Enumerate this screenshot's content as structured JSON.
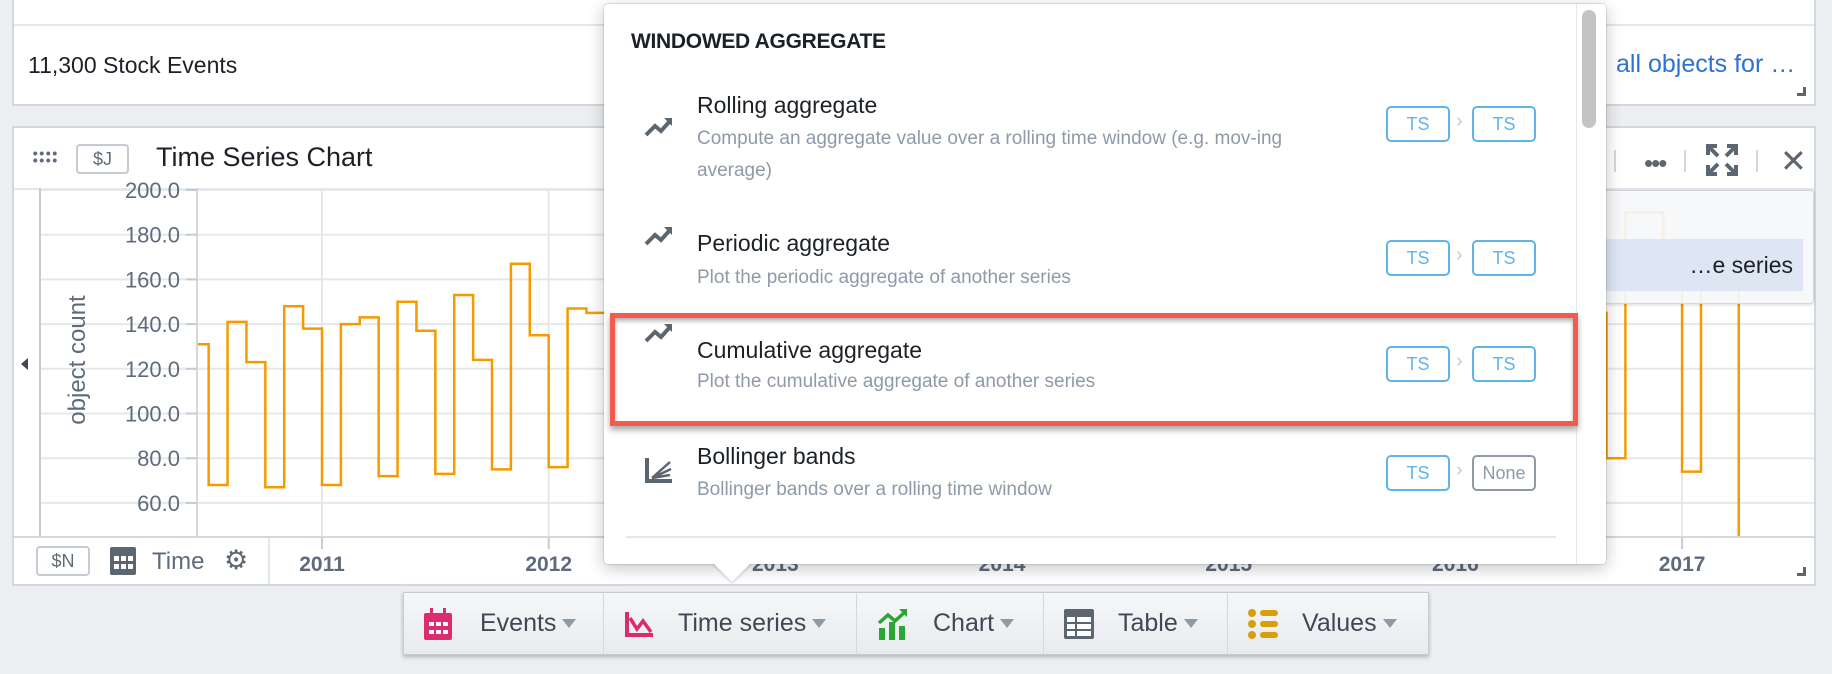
{
  "top_panel": {
    "title": "11,300 Stock Events",
    "link": "all objects for …"
  },
  "chart_panel": {
    "badge": "$J",
    "title": "Time Series Chart",
    "toolbar_icons": [
      "more-icon",
      "maximize-icon",
      "close-icon"
    ],
    "axis_badge": "$N",
    "axis_label": "Time",
    "popover_item": "…e series"
  },
  "chart_data": {
    "type": "line",
    "step": true,
    "ylabel": "object count",
    "ylim": [
      45,
      201
    ],
    "yticks": [
      "60.0",
      "80.0",
      "100.0",
      "120.0",
      "140.0",
      "160.0",
      "180.0",
      "200.0"
    ],
    "xticks": [
      "2011",
      "2012",
      "2013",
      "2014",
      "2015",
      "2016",
      "2017"
    ],
    "color": "#f59b00",
    "grid": true,
    "series": [
      {
        "points": [
          [
            "2010-06",
            131
          ],
          [
            "2010-07",
            68
          ],
          [
            "2010-08",
            141
          ],
          [
            "2010-09",
            123
          ],
          [
            "2010-10",
            67
          ],
          [
            "2010-11",
            148
          ],
          [
            "2010-12",
            138
          ],
          [
            "2011-01",
            68
          ],
          [
            "2011-02",
            140
          ],
          [
            "2011-03",
            143
          ],
          [
            "2011-04",
            72
          ],
          [
            "2011-05",
            150
          ],
          [
            "2011-06",
            137
          ],
          [
            "2011-07",
            73
          ],
          [
            "2011-08",
            153
          ],
          [
            "2011-09",
            124
          ],
          [
            "2011-10",
            75
          ],
          [
            "2011-11",
            167
          ],
          [
            "2011-12",
            135
          ],
          [
            "2012-01",
            76
          ],
          [
            "2012-02",
            147
          ],
          [
            "2012-03",
            145
          ],
          [
            "2016-08",
            145
          ],
          [
            "2016-09",
            80
          ],
          [
            "2016-10",
            190
          ],
          [
            "2016-11",
            190
          ],
          [
            "2016-12",
            170
          ],
          [
            "2017-01",
            74
          ],
          [
            "2017-02",
            168
          ],
          [
            "2017-03",
            170
          ]
        ]
      }
    ]
  },
  "dropdown": {
    "section": "WINDOWED AGGREGATE",
    "items": [
      {
        "title": "Rolling aggregate",
        "desc": "Compute an aggregate value over a rolling time window (e.g. mov-ing average)",
        "in": "TS",
        "out": "TS"
      },
      {
        "title": "Periodic aggregate",
        "desc": "Plot the periodic aggregate of another series",
        "in": "TS",
        "out": "TS"
      },
      {
        "title": "Cumulative aggregate",
        "desc": "Plot the cumulative aggregate of another series",
        "in": "TS",
        "out": "TS",
        "highlighted": true
      },
      {
        "title": "Bollinger bands",
        "desc": "Bollinger bands over a rolling time window",
        "in": "TS",
        "out": "None"
      }
    ],
    "highlight_color": "#f55a4e"
  },
  "bottom_toolbar": [
    {
      "label": "Events",
      "icon": "calendar-icon",
      "color": "#db2c6f"
    },
    {
      "label": "Time series",
      "icon": "line-chart-icon",
      "color": "#db2c6f"
    },
    {
      "label": "Chart",
      "icon": "trend-chart-icon",
      "color": "#29a634"
    },
    {
      "label": "Table",
      "icon": "table-icon",
      "color": "#5c6670"
    },
    {
      "label": "Values",
      "icon": "list-icon",
      "color": "#d99e0b"
    }
  ]
}
